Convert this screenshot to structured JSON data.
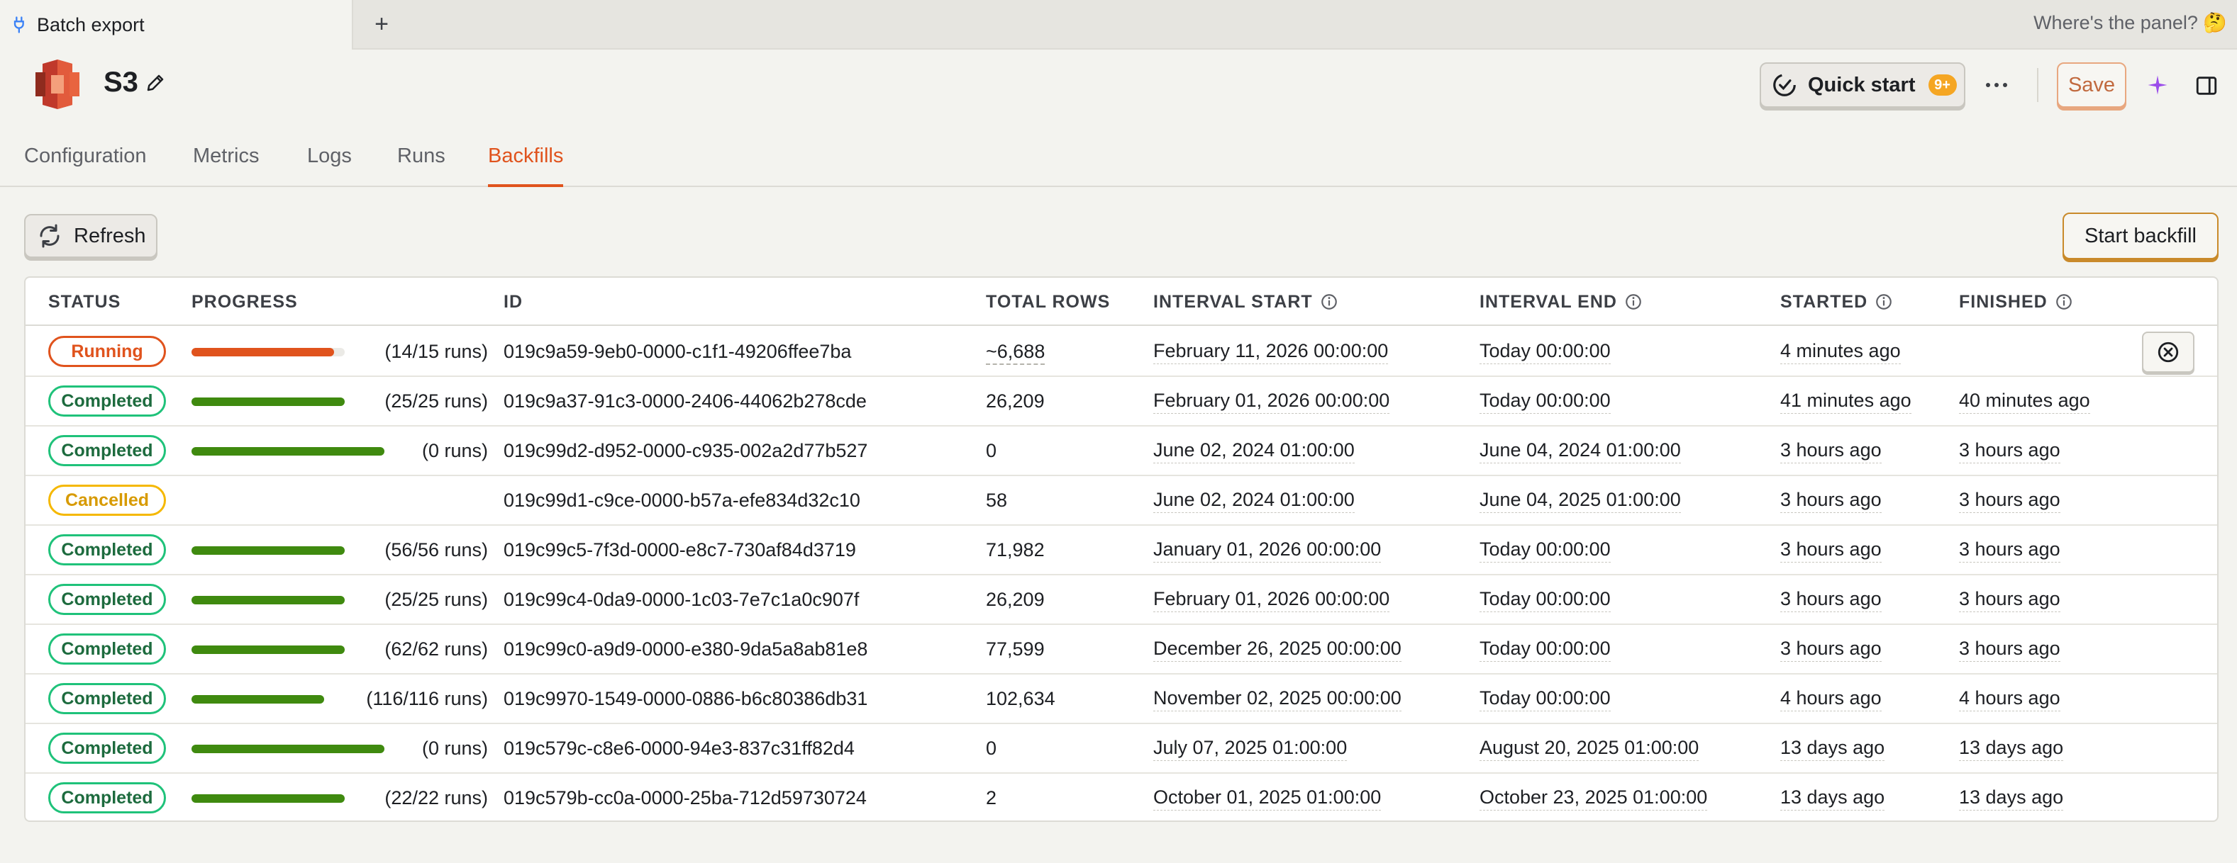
{
  "browser": {
    "tab_title": "Batch export",
    "new_tab_label": "+",
    "panel_hint": "Where's the panel? 🤔"
  },
  "header": {
    "title": "S3",
    "quick_start_label": "Quick start",
    "quick_start_badge": "9+",
    "save_label": "Save"
  },
  "subtabs": [
    {
      "label": "Configuration",
      "active": false
    },
    {
      "label": "Metrics",
      "active": false
    },
    {
      "label": "Logs",
      "active": false
    },
    {
      "label": "Runs",
      "active": false
    },
    {
      "label": "Backfills",
      "active": true
    }
  ],
  "toolbar": {
    "refresh_label": "Refresh",
    "start_backfill_label": "Start backfill"
  },
  "colors": {
    "accent": "#e0531d",
    "running": "#e0531d",
    "completed": "#1fc27a",
    "cancelled": "#f5b800",
    "progress_green": "#3f8a0f"
  },
  "table": {
    "columns": {
      "status": "STATUS",
      "progress": "PROGRESS",
      "id": "ID",
      "total_rows": "TOTAL ROWS",
      "interval_start": "INTERVAL START",
      "interval_end": "INTERVAL END",
      "started": "STARTED",
      "finished": "FINISHED"
    },
    "rows": [
      {
        "status": "Running",
        "progress": 0.93,
        "runs": "(14/15 runs)",
        "id": "019c9a59-9eb0-0000-c1f1-49206ffee7ba",
        "total_rows": "~6,688",
        "interval_start": "February 11, 2026 00:00:00",
        "interval_end": "Today 00:00:00",
        "started": "4 minutes ago",
        "finished": ""
      },
      {
        "status": "Completed",
        "progress": 1,
        "runs": "(25/25 runs)",
        "id": "019c9a37-91c3-0000-2406-44062b278cde",
        "total_rows": "26,209",
        "interval_start": "February 01, 2026 00:00:00",
        "interval_end": "Today 00:00:00",
        "started": "41 minutes ago",
        "finished": "40 minutes ago"
      },
      {
        "status": "Completed",
        "progress": 1,
        "runs": "(0 runs)",
        "id": "019c99d2-d952-0000-c935-002a2d77b527",
        "total_rows": "0",
        "interval_start": "June 02, 2024 01:00:00",
        "interval_end": "June 04, 2024 01:00:00",
        "started": "3 hours ago",
        "finished": "3 hours ago"
      },
      {
        "status": "Cancelled",
        "progress": null,
        "runs": "",
        "id": "019c99d1-c9ce-0000-b57a-efe834d32c10",
        "total_rows": "58",
        "interval_start": "June 02, 2024 01:00:00",
        "interval_end": "June 04, 2025 01:00:00",
        "started": "3 hours ago",
        "finished": "3 hours ago"
      },
      {
        "status": "Completed",
        "progress": 1,
        "runs": "(56/56 runs)",
        "id": "019c99c5-7f3d-0000-e8c7-730af84d3719",
        "total_rows": "71,982",
        "interval_start": "January 01, 2026 00:00:00",
        "interval_end": "Today 00:00:00",
        "started": "3 hours ago",
        "finished": "3 hours ago"
      },
      {
        "status": "Completed",
        "progress": 1,
        "runs": "(25/25 runs)",
        "id": "019c99c4-0da9-0000-1c03-7e7c1a0c907f",
        "total_rows": "26,209",
        "interval_start": "February 01, 2026 00:00:00",
        "interval_end": "Today 00:00:00",
        "started": "3 hours ago",
        "finished": "3 hours ago"
      },
      {
        "status": "Completed",
        "progress": 1,
        "runs": "(62/62 runs)",
        "id": "019c99c0-a9d9-0000-e380-9da5a8ab81e8",
        "total_rows": "77,599",
        "interval_start": "December 26, 2025 00:00:00",
        "interval_end": "Today 00:00:00",
        "started": "3 hours ago",
        "finished": "3 hours ago"
      },
      {
        "status": "Completed",
        "progress": 1,
        "runs": "(116/116 runs)",
        "id": "019c9970-1549-0000-0886-b6c80386db31",
        "total_rows": "102,634",
        "interval_start": "November 02, 2025 00:00:00",
        "interval_end": "Today 00:00:00",
        "started": "4 hours ago",
        "finished": "4 hours ago"
      },
      {
        "status": "Completed",
        "progress": 1,
        "runs": "(0 runs)",
        "id": "019c579c-c8e6-0000-94e3-837c31ff82d4",
        "total_rows": "0",
        "interval_start": "July 07, 2025 01:00:00",
        "interval_end": "August 20, 2025 01:00:00",
        "started": "13 days ago",
        "finished": "13 days ago"
      },
      {
        "status": "Completed",
        "progress": 1,
        "runs": "(22/22 runs)",
        "id": "019c579b-cc0a-0000-25ba-712d59730724",
        "total_rows": "2",
        "interval_start": "October 01, 2025 01:00:00",
        "interval_end": "October 23, 2025 01:00:00",
        "started": "13 days ago",
        "finished": "13 days ago"
      }
    ]
  }
}
